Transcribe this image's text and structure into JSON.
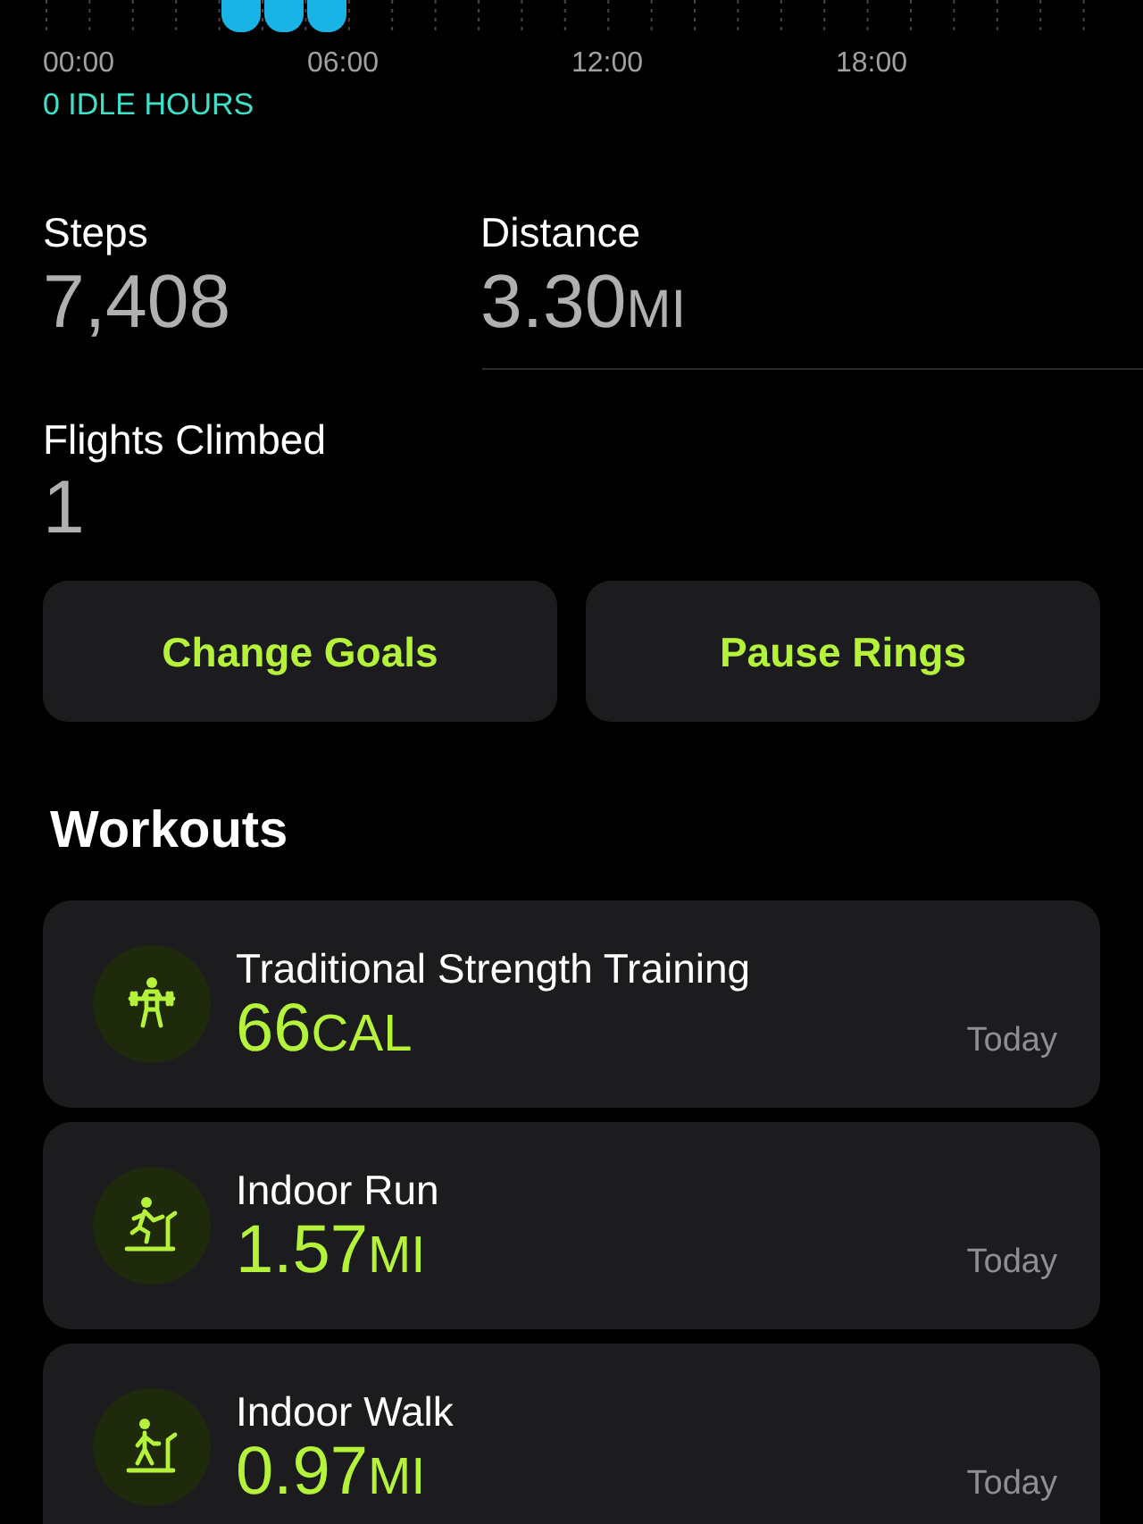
{
  "stand_chart": {
    "axis_labels": [
      "00:00",
      "06:00",
      "12:00",
      "18:00"
    ],
    "summary": "0 IDLE HOURS"
  },
  "stats": [
    {
      "label": "Steps",
      "value": "7,408"
    },
    {
      "label": "Distance",
      "value": "3.30",
      "unit": "MI"
    },
    {
      "label": "Flights Climbed",
      "value": "1"
    }
  ],
  "buttons": [
    "Change Goals",
    "Pause Rings"
  ],
  "workouts_title": "Workouts",
  "workouts": [
    {
      "kind": "strength",
      "name": "Traditional Strength Training",
      "value": "66",
      "unit": "CAL",
      "date": "Today"
    },
    {
      "kind": "run",
      "name": "Indoor Run",
      "value": "1.57",
      "unit": "MI",
      "date": "Today"
    },
    {
      "kind": "walk",
      "name": "Indoor Walk",
      "value": "0.97",
      "unit": "MI",
      "date": "Today"
    }
  ]
}
